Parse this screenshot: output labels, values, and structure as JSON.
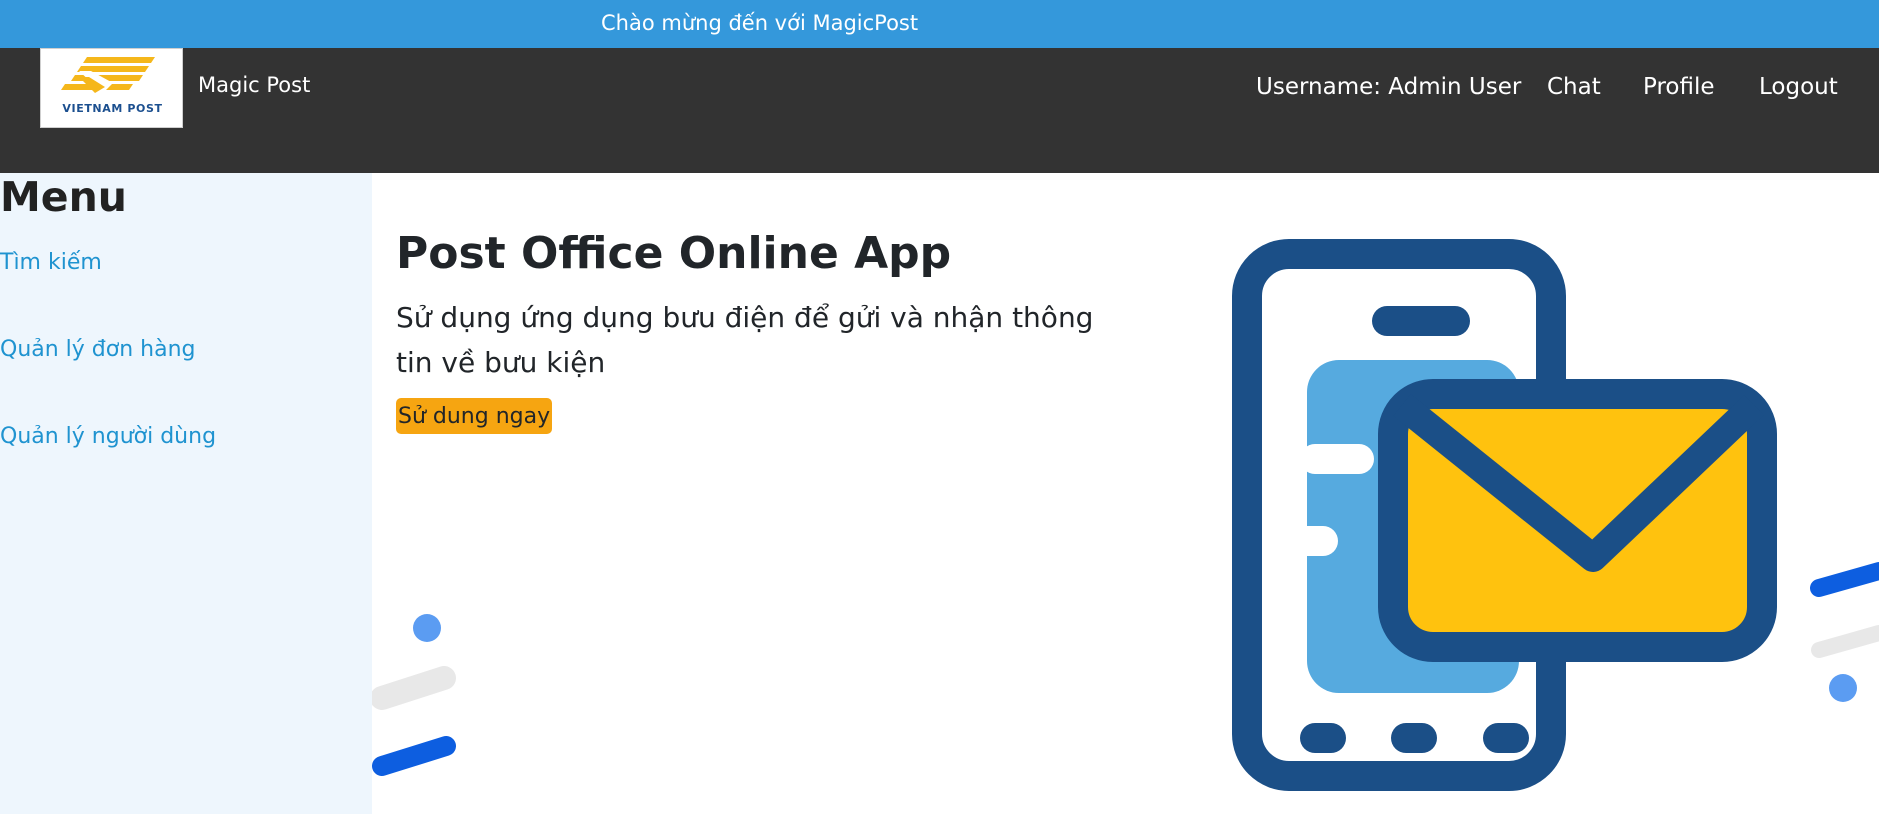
{
  "topbar": {
    "welcome": "Chào mừng đến với MagicPost"
  },
  "navbar": {
    "logo_text": "VIETNAM POST",
    "brand": "Magic Post",
    "username": "Username: Admin User",
    "chat": "Chat",
    "profile": "Profile",
    "logout": "Logout"
  },
  "sidebar": {
    "title": "Menu",
    "items": [
      {
        "label": "Tìm kiếm"
      },
      {
        "label": "Quản lý đơn hàng"
      },
      {
        "label": "Quản lý người dùng"
      }
    ]
  },
  "hero": {
    "title": "Post Office Online App",
    "text": "Sử dụng ứng dụng bưu điện để gửi và nhận thông tin về bưu kiện",
    "button": "Sử dung ngay"
  },
  "colors": {
    "topbar": "#3498db",
    "navbar": "#333333",
    "sidebar": "#eef6fd",
    "link": "#1f93d0",
    "cta": "#f6a511",
    "phone_frame": "#1b4f87",
    "phone_screen": "#56aadf",
    "envelope": "#ffc20e"
  }
}
